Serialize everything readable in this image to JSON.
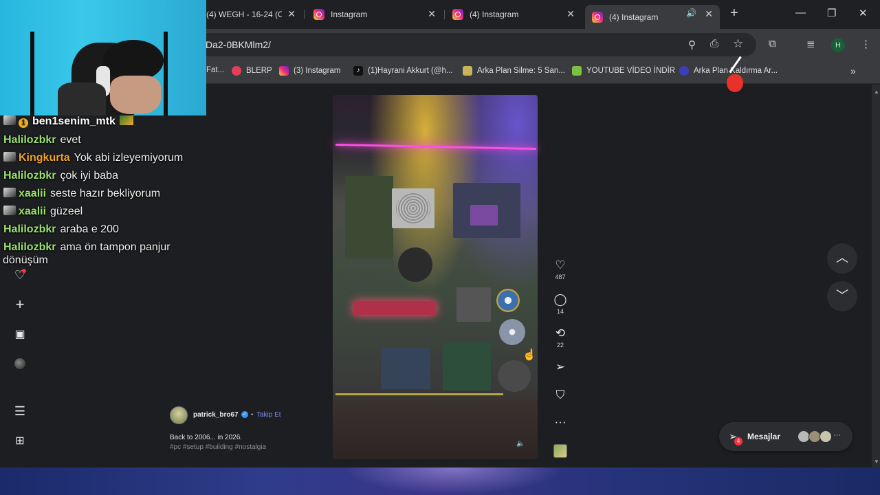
{
  "tabs": [
    {
      "label": "(4) WEGH - 16-24 (Off...",
      "active": false
    },
    {
      "label": "Instagram",
      "active": false
    },
    {
      "label": "(4) Instagram",
      "active": false
    },
    {
      "label": "(4) Instagram",
      "active": true
    }
  ],
  "address": {
    "url": "Da2-0BKMlm2/"
  },
  "profile_initial": "H",
  "bookmarks": [
    {
      "label": "Fat..."
    },
    {
      "label": "BLERP"
    },
    {
      "label": "(3) Instagram"
    },
    {
      "label": "(1)Hayrani Akkurt (@h..."
    },
    {
      "label": "Arka Plan Silme: 5 San..."
    },
    {
      "label": "YOUTUBE VİDEO İNDİR"
    },
    {
      "label": "Arka Plan Kaldırma Ar..."
    }
  ],
  "chat": [
    {
      "user": "ben1senim_mtk",
      "message": "",
      "color": "#ffffff"
    },
    {
      "user": "Halilozbkr",
      "message": "evet",
      "color": "#9be36f"
    },
    {
      "user": "Kingkurta",
      "message": "Yok abi izleyemiyorum",
      "color": "#f0a52a"
    },
    {
      "user": "Halilozbkr",
      "message": "çok iyi baba",
      "color": "#9be36f"
    },
    {
      "user": "xaalii",
      "message": "seste hazır bekliyorum",
      "color": "#9be36f"
    },
    {
      "user": "xaalii",
      "message": "güzeel",
      "color": "#9be36f"
    },
    {
      "user": "Halilozbkr",
      "message": "araba e 200",
      "color": "#9be36f"
    },
    {
      "user": "Halilozbkr",
      "message": "ama ön tampon panjur",
      "color": "#9be36f"
    },
    {
      "user": "",
      "message": "dönüşüm",
      "color": "#ffffff"
    }
  ],
  "reel": {
    "likes": "487",
    "comments": "14",
    "reposts": "22",
    "author": "patrick_bro67",
    "follow_label": "Takip Et",
    "caption": "Back to 2006... in 2026.",
    "hashtags": "#pc #setup #building #nostalgia"
  },
  "messages": {
    "label": "Mesajlar",
    "badge": "4"
  },
  "icons": {
    "tab_favicon": "instagram-icon",
    "nav": [
      "notifications-icon",
      "create-icon",
      "dashboard-icon",
      "profile-avatar",
      "menu-icon",
      "more-apps-icon"
    ],
    "toolbar": [
      "zoom-icon",
      "install-icon",
      "bookmark-star-icon",
      "extensions-icon",
      "media-icon",
      "kebab-menu-icon"
    ]
  },
  "colors": {
    "accent_follow": "#7e8cf0",
    "badge_red": "#ff3040",
    "neon_pink": "#ff4fe2"
  }
}
